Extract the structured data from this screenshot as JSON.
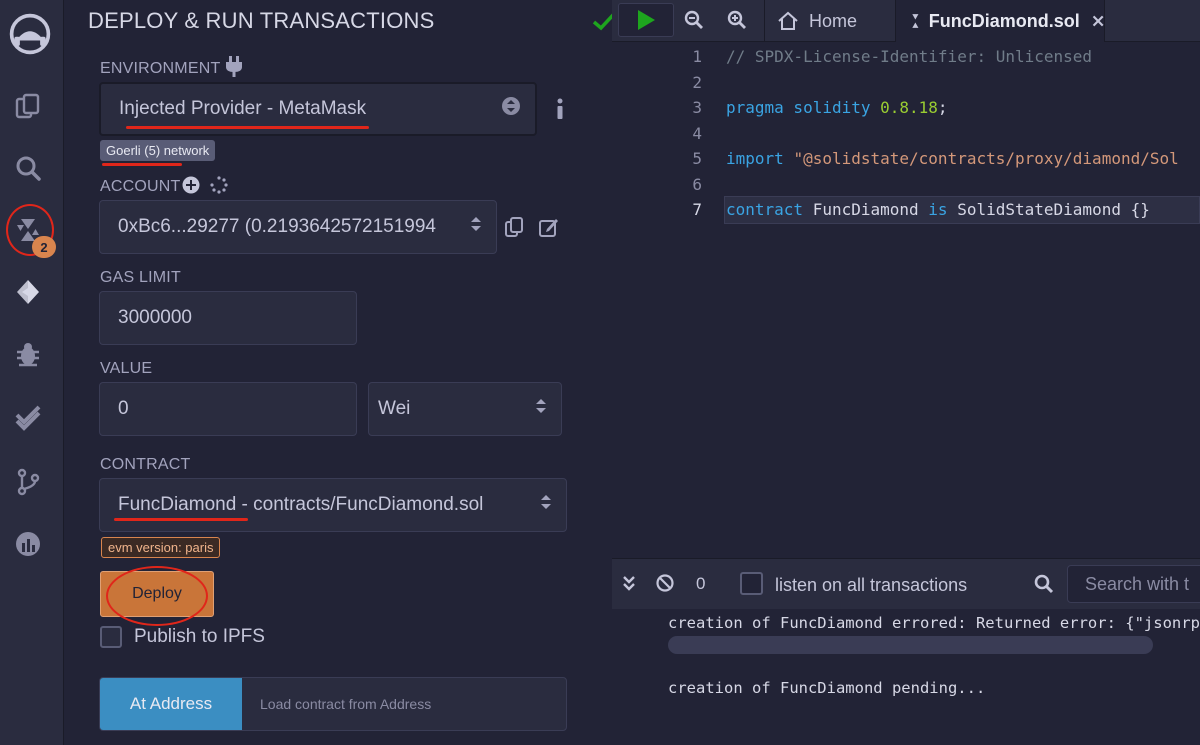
{
  "panel": {
    "title": "DEPLOY & RUN TRANSACTIONS",
    "environment_label": "ENVIRONMENT",
    "environment_value": "Injected Provider - MetaMask",
    "network_badge": "Goerli (5) network",
    "account_label": "ACCOUNT",
    "account_value": "0xBc6...29277 (0.2193642572151994",
    "gas_limit_label": "GAS LIMIT",
    "gas_limit_value": "3000000",
    "value_label": "VALUE",
    "value_amount": "0",
    "value_unit": "Wei",
    "contract_label": "CONTRACT",
    "contract_name": "FuncDiamond",
    "contract_path": " - contracts/FuncDiamond.sol",
    "evm_badge": "evm version: paris",
    "deploy_label": "Deploy",
    "publish_label": "Publish to IPFS",
    "at_address_label": "At Address",
    "load_contract_placeholder": "Load contract from Address"
  },
  "rail": {
    "badge_count": "2"
  },
  "editor": {
    "tabs": [
      {
        "label": "Home"
      },
      {
        "label": "FuncDiamond.sol"
      }
    ],
    "line_numbers": [
      "1",
      "2",
      "3",
      "4",
      "5",
      "6",
      "7"
    ],
    "code": {
      "line1": "// SPDX-License-Identifier: Unlicensed",
      "l3_kw": "pragma solidity ",
      "l3_ver": "0.8.18",
      "l3_end": ";",
      "l5_kw": "import ",
      "l5_str": "\"@solidstate/contracts/proxy/diamond/Sol",
      "l7_kw1": "contract ",
      "l7_name": "FuncDiamond ",
      "l7_kw2": "is ",
      "l7_rest": "SolidStateDiamond {}"
    }
  },
  "terminal": {
    "count": "0",
    "listen_label": "listen on all transactions",
    "search_placeholder": "Search with t",
    "log1": "creation of FuncDiamond errored: Returned error: {\"jsonrpc",
    "log2": "creation of FuncDiamond pending..."
  },
  "colors": {
    "accent_blue": "#3aa4e3",
    "deploy_orange": "#c97539",
    "annotation_red": "#e0261a",
    "check_green": "#1ea51e"
  }
}
